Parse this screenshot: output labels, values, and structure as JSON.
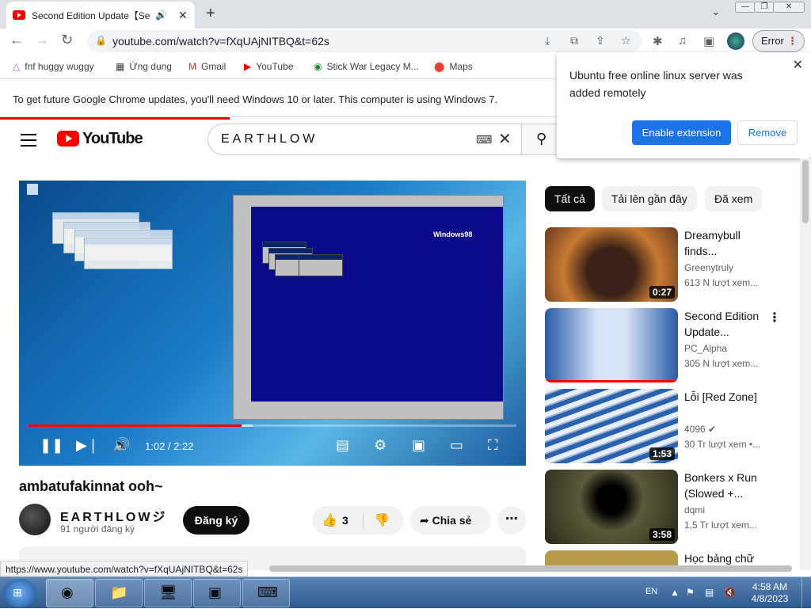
{
  "browser": {
    "tab_title": "Second Edition Update【Seco",
    "tab_audio_icon": "speaker-icon",
    "url": "youtube.com/watch?v=fXqUAjNITBQ&t=62s",
    "error_label": "Error",
    "bookmarks": [
      {
        "label": "fnf huggy wuggy",
        "icon": "triangle-icon"
      },
      {
        "label": "Ứng dụng",
        "icon": "apps-grid-icon"
      },
      {
        "label": "Gmail",
        "icon": "gmail-icon"
      },
      {
        "label": "YouTube",
        "icon": "youtube-icon"
      },
      {
        "label": "Stick War Legacy M...",
        "icon": "stickwar-icon"
      },
      {
        "label": "Maps",
        "icon": "maps-pin-icon"
      }
    ],
    "infobar_text": "To get future Google Chrome updates, you'll need Windows 10 or later. This computer is using Windows 7.",
    "status_url": "https://www.youtube.com/watch?v=fXqUAjNITBQ&t=62s"
  },
  "popup": {
    "message": "Ubuntu free online linux server was added remotely",
    "enable_label": "Enable extension",
    "remove_label": "Remove"
  },
  "youtube": {
    "logo_text": "YouTube",
    "search_value": "EARTHLOW",
    "video": {
      "time": "1:02 / 2:22",
      "progress_fraction": 0.437,
      "buffered_fraction": 0.46,
      "vm_logo_text": "Windows98"
    },
    "title": "ambatufakinnat ooh~",
    "channel_name": "EARTHLOWジ",
    "subscribers": "91 người đăng ký",
    "subscribe_label": "Đăng ký",
    "like_count": "3",
    "share_label": "Chia sẻ",
    "chips": [
      "Tất cả",
      "Tải lên gần đây",
      "Đã xem"
    ],
    "recommendations": [
      {
        "title": "Dreamybull finds...",
        "channel": "Greenytruly",
        "views": "613 N lượt xem...",
        "duration": "0:27",
        "thumb_color": "#8a4a2a"
      },
      {
        "title": "Second Edition Update...",
        "channel": "PC_Alpha",
        "views": "305 N lượt xem...",
        "duration": "",
        "thumb_color": "#3a6fb8"
      },
      {
        "title": "Lỗi [Red Zone]",
        "channel": "4096",
        "views": "30 Tr lượt xem  •...",
        "duration": "1:53",
        "thumb_color": "#6aa0d8"
      },
      {
        "title": "Bonkers x Run (Slowed +...",
        "channel": "dqmi",
        "views": "1,5 Tr lượt xem...",
        "duration": "3:58",
        "thumb_color": "#2a2a1a"
      },
      {
        "title": "Học bảng chữ",
        "channel": "",
        "views": "",
        "duration": "",
        "thumb_color": "#b89a4a"
      }
    ]
  },
  "taskbar": {
    "language": "EN",
    "time": "4:58 AM",
    "date": "4/8/2023"
  }
}
